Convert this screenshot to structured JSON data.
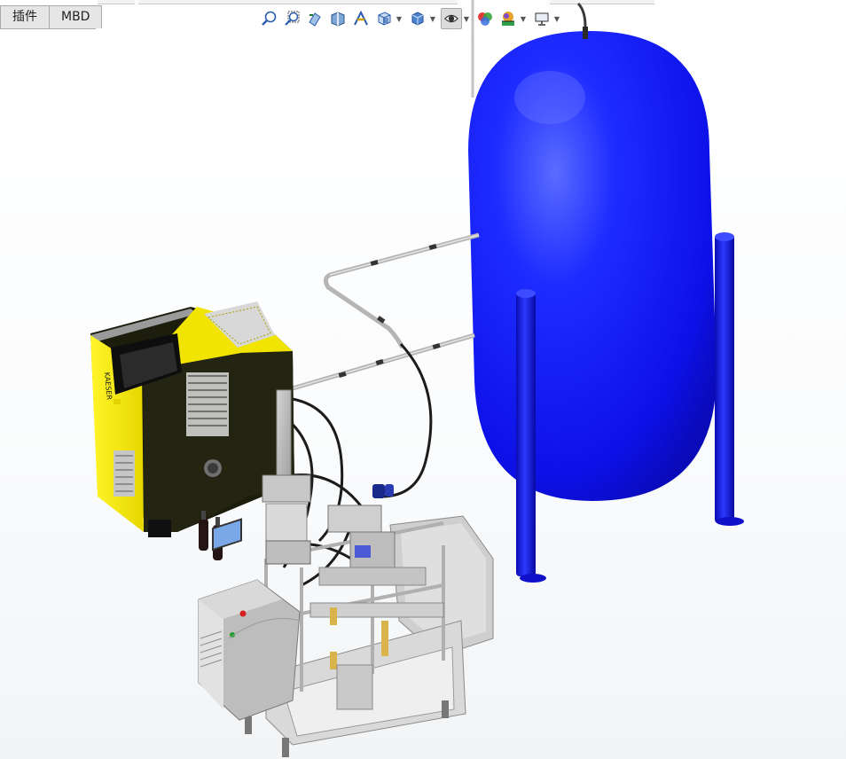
{
  "tabs": [
    {
      "label": "插件"
    },
    {
      "label": "MBD"
    }
  ],
  "heads_up_toolbar": {
    "tools": [
      {
        "icon": "zoom-to-fit-icon"
      },
      {
        "icon": "zoom-to-area-icon"
      },
      {
        "icon": "previous-view-icon"
      },
      {
        "icon": "section-view-icon"
      },
      {
        "icon": "dynamic-annotation-views-icon"
      },
      {
        "icon": "view-orientation-icon",
        "dropdown": true
      },
      {
        "icon": "display-style-icon",
        "dropdown": true
      },
      {
        "icon": "hide-show-items-icon",
        "dropdown": true,
        "active": true
      },
      {
        "icon": "edit-appearance-icon"
      },
      {
        "icon": "apply-scene-icon",
        "dropdown": true
      },
      {
        "icon": "view-settings-icon",
        "dropdown": true
      }
    ]
  },
  "colors": {
    "tank": "#1a1aff",
    "compressor_body": "#f2e600",
    "compressor_dark": "#1e1e10",
    "frame": "#b9b9b9"
  }
}
